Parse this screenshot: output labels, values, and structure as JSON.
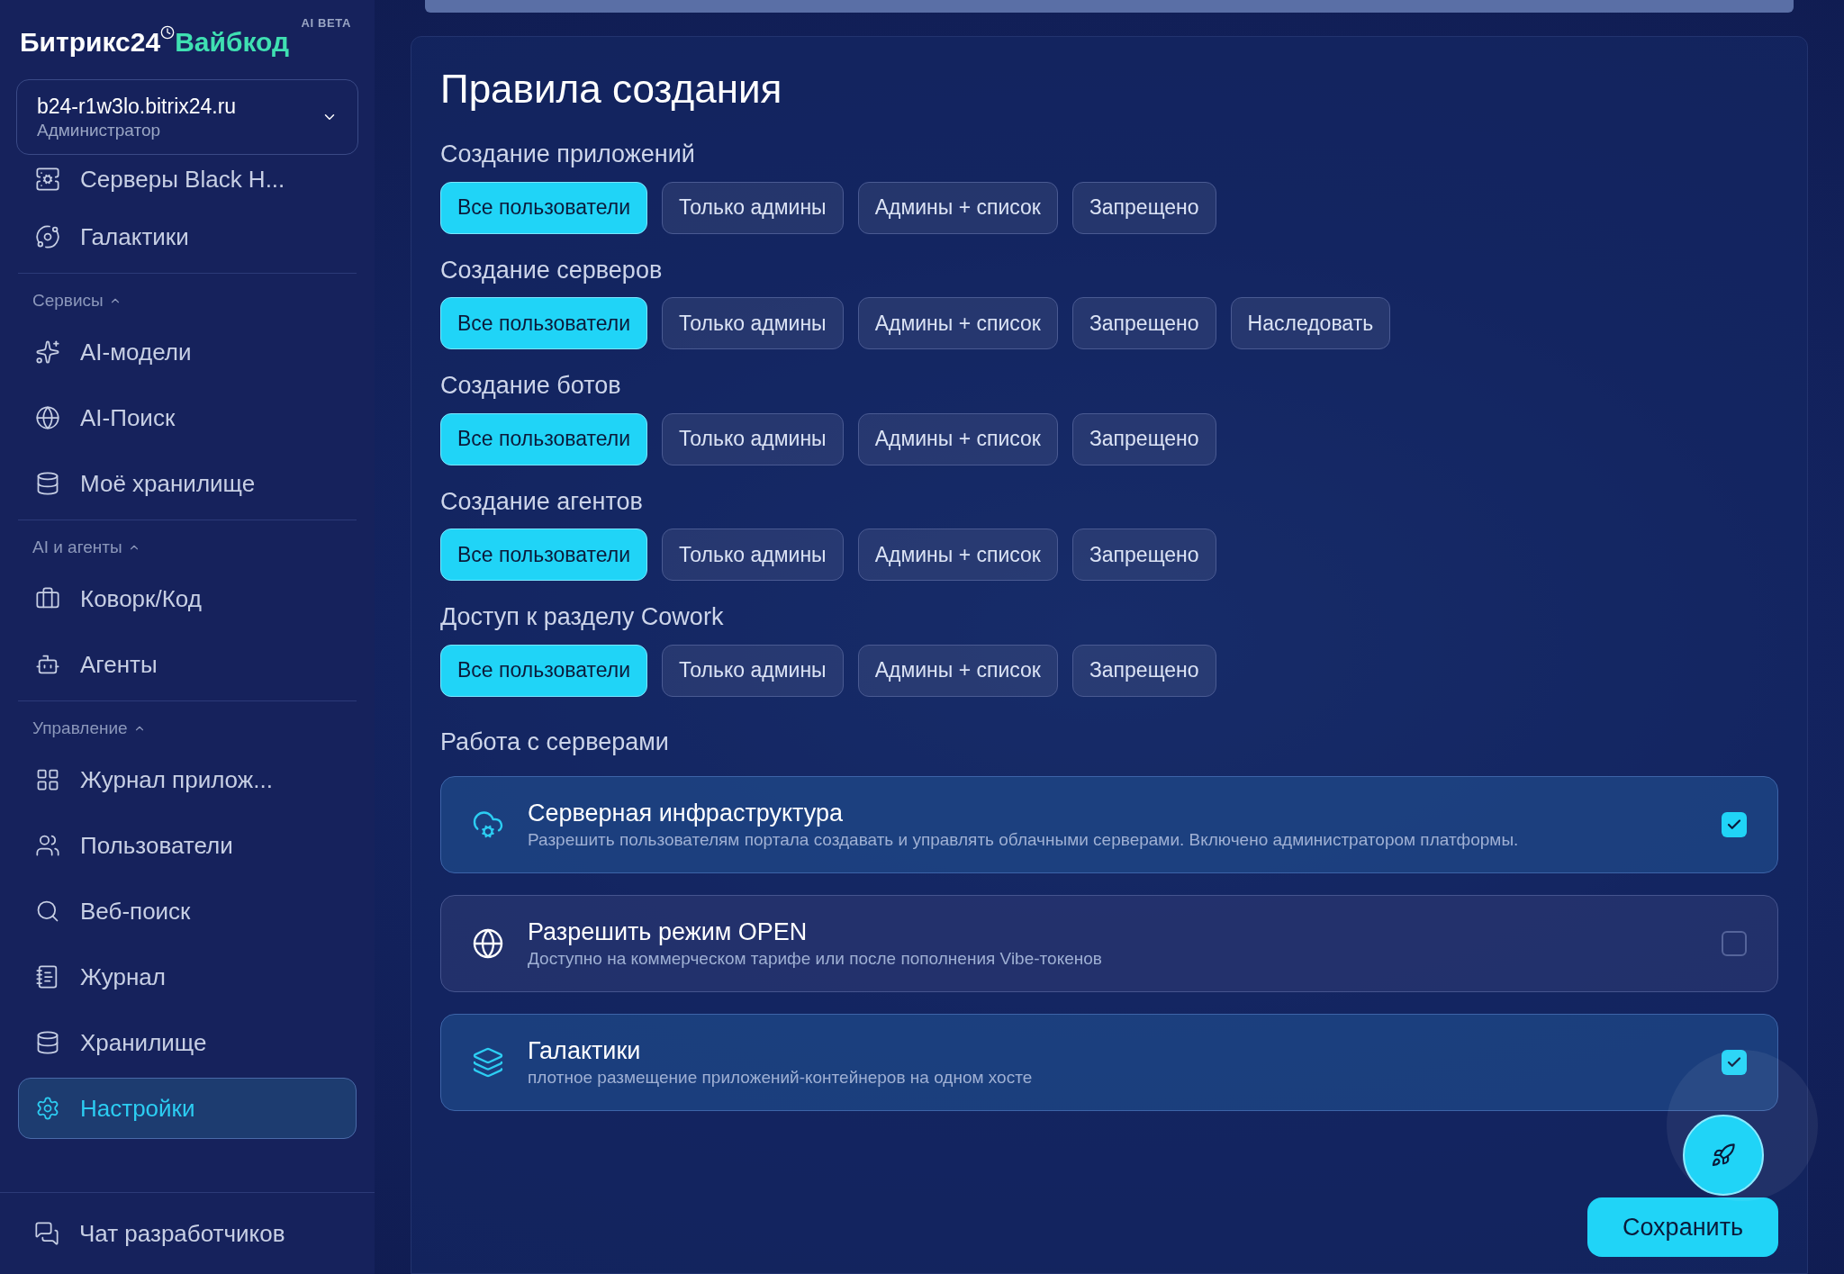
{
  "sidebar": {
    "logo": {
      "brand": "Битрикс24",
      "product": "Вайбкод",
      "badge": "AI BETA"
    },
    "account": {
      "domain": "b24-r1w3lo.bitrix24.ru",
      "role": "Администратор"
    },
    "groups": [
      {
        "items": [
          {
            "label": "Серверы Black H...",
            "selected": false
          },
          {
            "label": "Галактики",
            "selected": false
          }
        ]
      },
      {
        "header": "Сервисы",
        "expanded": true,
        "items": [
          {
            "label": "AI-модели",
            "selected": false
          },
          {
            "label": "AI-Поиск",
            "selected": false
          },
          {
            "label": "Моё хранилище",
            "selected": false
          }
        ]
      },
      {
        "header": "AI и агенты",
        "expanded": true,
        "items": [
          {
            "label": "Коворк/Код",
            "selected": false
          },
          {
            "label": "Агенты",
            "selected": false
          }
        ]
      },
      {
        "header": "Управление",
        "expanded": true,
        "items": [
          {
            "label": "Журнал прилож...",
            "selected": false
          },
          {
            "label": "Пользователи",
            "selected": false
          },
          {
            "label": "Веб-поиск",
            "selected": false
          },
          {
            "label": "Журнал",
            "selected": false
          },
          {
            "label": "Хранилище",
            "selected": false
          },
          {
            "label": "Настройки",
            "selected": true
          }
        ]
      }
    ],
    "footer_item": {
      "label": "Чат разработчиков"
    }
  },
  "main": {
    "title": "Правила создания",
    "rules": [
      {
        "label": "Создание приложений",
        "options": [
          {
            "label": "Все пользователи",
            "selected": true
          },
          {
            "label": "Только админы",
            "selected": false
          },
          {
            "label": "Админы + список",
            "selected": false
          },
          {
            "label": "Запрещено",
            "selected": false
          }
        ]
      },
      {
        "label": "Создание серверов",
        "options": [
          {
            "label": "Все пользователи",
            "selected": true
          },
          {
            "label": "Только админы",
            "selected": false
          },
          {
            "label": "Админы + список",
            "selected": false
          },
          {
            "label": "Запрещено",
            "selected": false
          },
          {
            "label": "Наследовать",
            "selected": false
          }
        ]
      },
      {
        "label": "Создание ботов",
        "options": [
          {
            "label": "Все пользователи",
            "selected": true
          },
          {
            "label": "Только админы",
            "selected": false
          },
          {
            "label": "Админы + список",
            "selected": false
          },
          {
            "label": "Запрещено",
            "selected": false
          }
        ]
      },
      {
        "label": "Создание агентов",
        "options": [
          {
            "label": "Все пользователи",
            "selected": true
          },
          {
            "label": "Только админы",
            "selected": false
          },
          {
            "label": "Админы + список",
            "selected": false
          },
          {
            "label": "Запрещено",
            "selected": false
          }
        ]
      },
      {
        "label": "Доступ к разделу Cowork",
        "options": [
          {
            "label": "Все пользователи",
            "selected": true
          },
          {
            "label": "Только админы",
            "selected": false
          },
          {
            "label": "Админы + список",
            "selected": false
          },
          {
            "label": "Запрещено",
            "selected": false
          }
        ]
      }
    ],
    "servers_title": "Работа с серверами",
    "cards": [
      {
        "title": "Серверная инфраструктура",
        "description": "Разрешить пользователям портала создавать и управлять облачными серверами. Включено администратором платформы.",
        "checked": true
      },
      {
        "title": "Разрешить режим OPEN",
        "description": "Доступно на коммерческом тарифе или после пополнения Vibe-токенов",
        "checked": false
      },
      {
        "title": "Галактики",
        "description": "плотное размещение приложений-контейнеров на одном хосте",
        "checked": true
      }
    ],
    "save_button": "Сохранить"
  }
}
